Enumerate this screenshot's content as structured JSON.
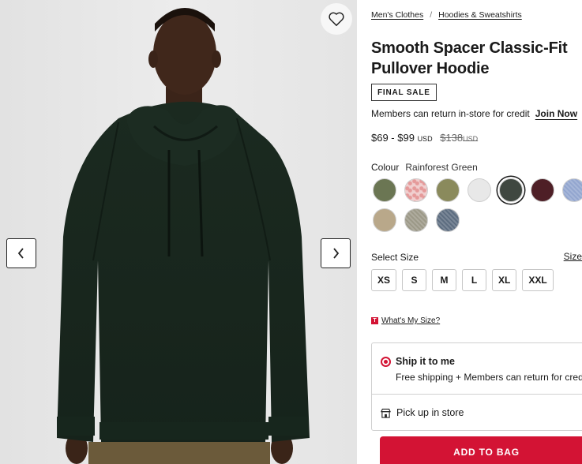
{
  "breadcrumb": {
    "items": [
      "Men's Clothes",
      "Hoodies & Sweatshirts"
    ],
    "separator": "/"
  },
  "product": {
    "title": "Smooth Spacer Classic-Fit Pullover Hoodie",
    "badge": "FINAL SALE",
    "members_text": "Members can return in-store for credit",
    "join_label": "Join Now",
    "price": {
      "range": "$69 - $99",
      "currency": "USD",
      "original": "$138",
      "original_currency": "USD"
    }
  },
  "colour": {
    "label": "Colour",
    "selected_name": "Rainforest Green",
    "swatches": [
      {
        "color": "#6b7653",
        "pattern": "solid"
      },
      {
        "color": "#f0cfcf",
        "pattern": "print"
      },
      {
        "color": "#8a8a5c",
        "pattern": "solid"
      },
      {
        "color": "#e8e8e8",
        "pattern": "solid"
      },
      {
        "color": "#3f4740",
        "pattern": "solid",
        "selected": true
      },
      {
        "color": "#4e1f26",
        "pattern": "solid"
      },
      {
        "color": "#93a6cf",
        "pattern": "heather"
      },
      {
        "color": "#b9a88a",
        "pattern": "solid"
      },
      {
        "color": "#9c9988",
        "pattern": "heather"
      },
      {
        "color": "#5d6d80",
        "pattern": "heather"
      }
    ]
  },
  "size": {
    "label": "Select Size",
    "guide_label": "Size",
    "options": [
      "XS",
      "S",
      "M",
      "L",
      "XL",
      "XXL"
    ],
    "whats_my_size_icon": "T",
    "whats_my_size": "What's My Size?"
  },
  "shipping": {
    "ship_title": "Ship it to me",
    "ship_sub": "Free shipping + Members can return for credit",
    "pickup_label": "Pick up in store"
  },
  "cta": {
    "add_to_bag": "ADD TO BAG"
  },
  "icons": {
    "favorite": "heart-icon",
    "prev": "chevron-left-icon",
    "next": "chevron-right-icon",
    "store": "store-icon"
  },
  "colors": {
    "accent": "#d31334",
    "hoodie": "#1f2e24"
  }
}
